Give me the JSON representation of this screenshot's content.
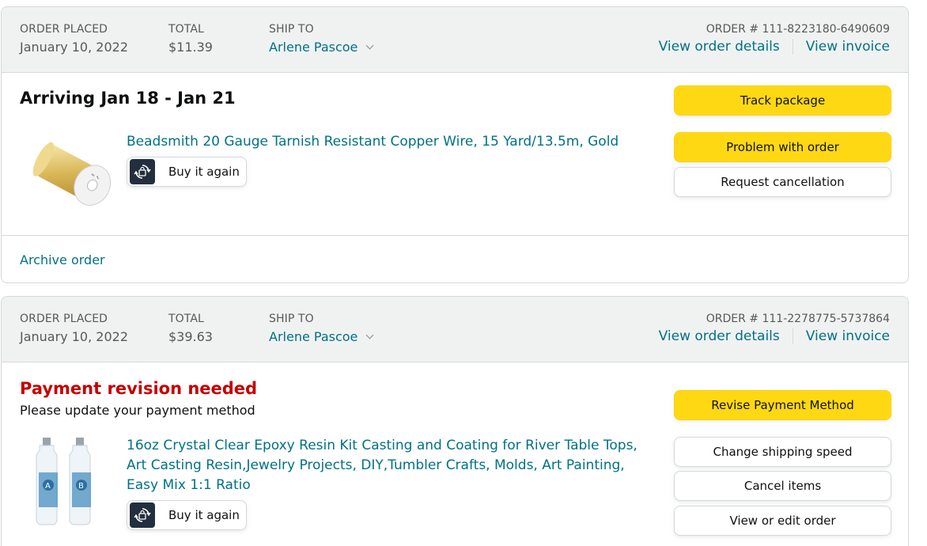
{
  "orders": [
    {
      "header": {
        "placed_label": "ORDER PLACED",
        "placed_value": "January 10, 2022",
        "total_label": "TOTAL",
        "total_value": "$11.39",
        "ship_label": "SHIP TO",
        "ship_value": "Arlene Pascoe",
        "order_number": "ORDER # 111-8223180-6490609",
        "details_link": "View order details",
        "invoice_link": "View invoice"
      },
      "status_title": "Arriving Jan 18 - Jan 21",
      "item": {
        "title": "Beadsmith 20 Gauge Tarnish Resistant Copper Wire, 15 Yard/13.5m, Gold",
        "buy_again": "Buy it again",
        "image": "gold-wire-spool"
      },
      "actions": [
        "Track package",
        "Problem with order",
        "Request cancellation"
      ],
      "archive": "Archive order"
    },
    {
      "header": {
        "placed_label": "ORDER PLACED",
        "placed_value": "January 10, 2022",
        "total_label": "TOTAL",
        "total_value": "$39.63",
        "ship_label": "SHIP TO",
        "ship_value": "Arlene Pascoe",
        "order_number": "ORDER # 111-2278775-5737864",
        "details_link": "View order details",
        "invoice_link": "View invoice"
      },
      "status_title": "Payment revision needed",
      "status_subtitle": "Please update your payment method",
      "item": {
        "title": "16oz Crystal Clear Epoxy Resin Kit Casting and Coating for River Table Tops, Art Casting Resin,Jewelry Projects, DIY,Tumbler Crafts, Molds, Art Painting, Easy Mix 1:1 Ratio",
        "buy_again": "Buy it again",
        "image": "epoxy-resin-bottles"
      },
      "actions": [
        "Revise Payment Method",
        "Change shipping speed",
        "Cancel items",
        "View or edit order"
      ]
    }
  ],
  "colors": {
    "link": "#007185",
    "alert": "#c40000",
    "button_yellow": "#ffd814",
    "header_bg": "#f0f2f2",
    "border": "#d5d9d9"
  }
}
